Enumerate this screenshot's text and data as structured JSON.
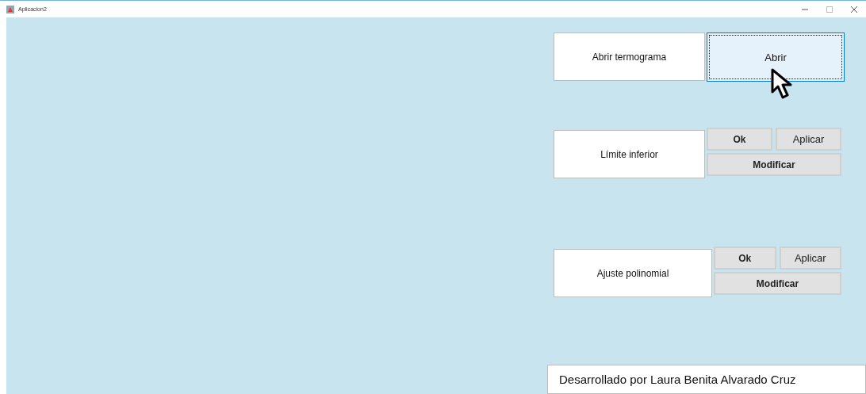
{
  "window": {
    "title": "Aplicacion2"
  },
  "sections": [
    {
      "kind": "single",
      "label": "Abrir termograma",
      "button": {
        "label": "Abrir",
        "focused": true
      }
    },
    {
      "kind": "triple",
      "label": "Límite inferior",
      "ok": "Ok",
      "apply": "Aplicar",
      "modify": "Modificar"
    },
    {
      "kind": "triple",
      "label": "Ajuste polinomial",
      "ok": "Ok",
      "apply": "Aplicar",
      "modify": "Modificar"
    }
  ],
  "footer": "Desarrollado por Laura Benita Alvarado Cruz"
}
